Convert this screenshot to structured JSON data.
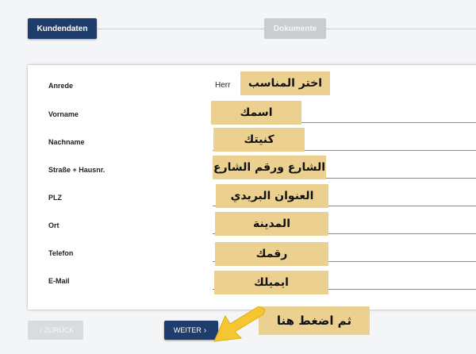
{
  "stepper": {
    "steps": [
      {
        "label": "Kundendaten",
        "state": "active"
      },
      {
        "label": "Dokumente",
        "state": "inactive"
      }
    ]
  },
  "form": {
    "fields": [
      {
        "label": "Anrede",
        "value": "Herr"
      },
      {
        "label": "Vorname",
        "value": ""
      },
      {
        "label": "Nachname",
        "value": ""
      },
      {
        "label": "Straße + Hausnr.",
        "value": ""
      },
      {
        "label": "PLZ",
        "value": ""
      },
      {
        "label": "Ort",
        "value": ""
      },
      {
        "label": "Telefon",
        "value": ""
      },
      {
        "label": "E-Mail",
        "value": ""
      }
    ]
  },
  "annotations": [
    "اختر المناسب",
    "اسمك",
    "كنيتك",
    "الشارع ورقم الشارع",
    "العنوان البريدي",
    "المدينة",
    "رقمك",
    "ايميلك",
    "ثم اضغط هنا"
  ],
  "buttons": {
    "back_label": "ZURÜCK",
    "back_icon": "chevron-left-icon",
    "next_label": "WEITER",
    "next_icon": "chevron-right-icon"
  },
  "colors": {
    "primary": "#1f3d6c",
    "inactive": "#c9ccd0",
    "annotation": "#ecd08f",
    "arrow": "#f5c631"
  }
}
